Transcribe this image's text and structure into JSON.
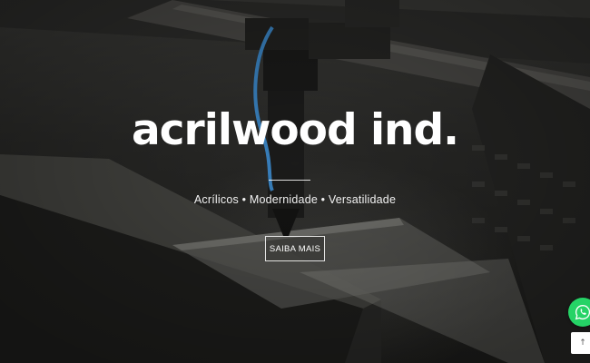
{
  "hero": {
    "brand": "acrilwood ind.",
    "tagline": "Acrílicos • Modernidade • Versatilidade",
    "cta_label": "SAIBA MAIS"
  },
  "floating": {
    "whatsapp_icon": "whatsapp-icon",
    "back_to_top_icon": "arrow-up-icon",
    "back_to_top_label": "↑"
  },
  "colors": {
    "whatsapp": "#25d366",
    "text": "#ffffff"
  }
}
